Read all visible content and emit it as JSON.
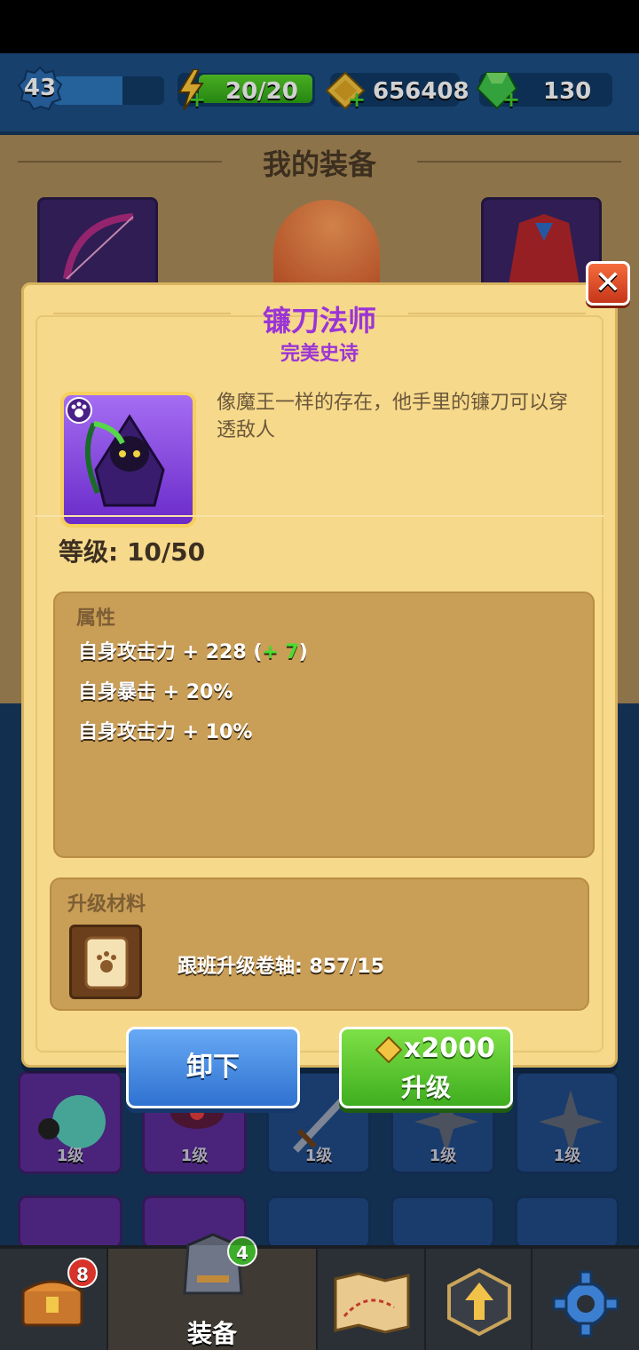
{
  "hud": {
    "player_level": "43",
    "xp_progress": 0.62,
    "energy": "20/20",
    "gold": "656408",
    "gems": "130"
  },
  "page": {
    "title": "我的装备"
  },
  "item_dialog": {
    "name": "镰刀法师",
    "rarity": "完美史诗",
    "description": "像魔王一样的存在，他手里的镰刀可以穿透敌人",
    "level": "等级: 10/50",
    "attributes_title": "属性",
    "attributes": [
      {
        "text": "自身攻击力 + 228 (",
        "bonus": "+ 7",
        "suffix": ")"
      },
      {
        "text": "自身暴击 + 20%"
      },
      {
        "text": "自身攻击力 + 10%"
      }
    ],
    "materials_title": "升级材料",
    "material_text": "跟班升级卷轴: 857/15",
    "unequip_label": "卸下",
    "upgrade_cost": "x2000",
    "upgrade_label": "升级",
    "close_icon": "close-icon"
  },
  "inventory": {
    "slots": [
      {
        "level": "1级",
        "color": "purple"
      },
      {
        "level": "1级",
        "color": "purple"
      },
      {
        "level": "1级",
        "color": "blue"
      },
      {
        "level": "1级",
        "color": "blue"
      },
      {
        "level": "1级",
        "color": "blue"
      }
    ]
  },
  "nav": {
    "chest_badge": "8",
    "equip_badge": "4",
    "equip_label": "装备"
  },
  "colors": {
    "epic_purple": "#9b34d6",
    "bonus_green": "#45e02e",
    "panel_tan": "#c99e56"
  }
}
